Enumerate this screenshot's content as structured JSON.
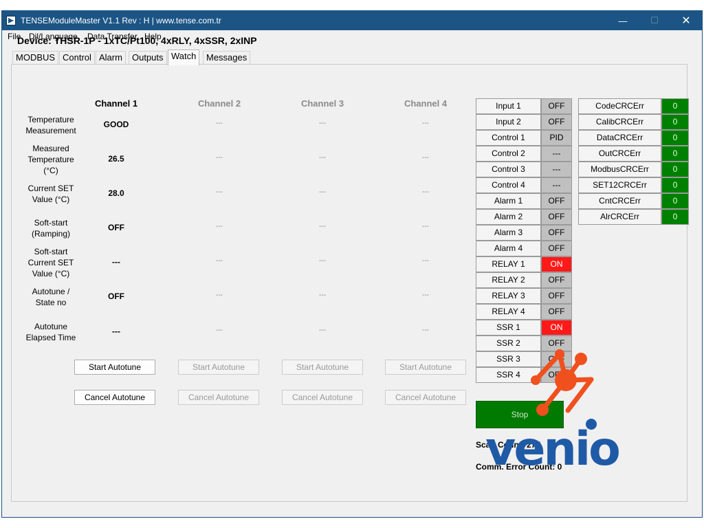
{
  "window": {
    "title": "TENSEModuleMaster V1.1 Rev : H  |  www.tense.com.tr",
    "controls": {
      "minimize": "—",
      "maximize": "☐",
      "close": "✕"
    }
  },
  "menu": [
    "File",
    "Dil/Language",
    "Data Transfer",
    "Help"
  ],
  "device_title": "Device: THSR-1P  -  1xTC/Pt100, 4xRLY, 4xSSR, 2xINP",
  "tabs": [
    "MODBUS",
    "Control",
    "Alarm",
    "Outputs",
    "Watch",
    "Messages"
  ],
  "active_tab": "Watch",
  "channels": [
    "Channel 1",
    "Channel 2",
    "Channel 3",
    "Channel 4"
  ],
  "rows": [
    {
      "label": "Temperature\nMeasurement",
      "values": [
        "GOOD",
        "---",
        "---",
        "---"
      ]
    },
    {
      "label": "Measured\nTemperature\n(°C)",
      "values": [
        "26.5",
        "---",
        "---",
        "---"
      ]
    },
    {
      "label": "Current SET\nValue (°C)",
      "values": [
        "28.0",
        "---",
        "---",
        "---"
      ]
    },
    {
      "label": "Soft-start\n(Ramping)",
      "values": [
        "OFF",
        "---",
        "---",
        "---"
      ]
    },
    {
      "label": "Soft-start\nCurrent SET\nValue (°C)",
      "values": [
        "---",
        "---",
        "---",
        "---"
      ]
    },
    {
      "label": "Autotune /\nState no",
      "values": [
        "OFF",
        "---",
        "---",
        "---"
      ]
    },
    {
      "label": "Autotune\nElapsed Time",
      "values": [
        "---",
        "---",
        "---",
        "---"
      ]
    }
  ],
  "buttons": {
    "start_autotune": "Start Autotune",
    "cancel_autotune": "Cancel Autotune"
  },
  "status": [
    {
      "label": "Input 1",
      "value": "OFF",
      "state": "off"
    },
    {
      "label": "Input 2",
      "value": "OFF",
      "state": "off"
    },
    {
      "label": "Control 1",
      "value": "PID",
      "state": "off"
    },
    {
      "label": "Control 2",
      "value": "---",
      "state": "off"
    },
    {
      "label": "Control 3",
      "value": "---",
      "state": "off"
    },
    {
      "label": "Control 4",
      "value": "---",
      "state": "off"
    },
    {
      "label": "Alarm 1",
      "value": "OFF",
      "state": "off"
    },
    {
      "label": "Alarm 2",
      "value": "OFF",
      "state": "off"
    },
    {
      "label": "Alarm 3",
      "value": "OFF",
      "state": "off"
    },
    {
      "label": "Alarm 4",
      "value": "OFF",
      "state": "off"
    },
    {
      "label": "RELAY 1",
      "value": "ON",
      "state": "on"
    },
    {
      "label": "RELAY 2",
      "value": "OFF",
      "state": "off"
    },
    {
      "label": "RELAY 3",
      "value": "OFF",
      "state": "off"
    },
    {
      "label": "RELAY 4",
      "value": "OFF",
      "state": "off"
    },
    {
      "label": "SSR 1",
      "value": "ON",
      "state": "on"
    },
    {
      "label": "SSR 2",
      "value": "OFF",
      "state": "off"
    },
    {
      "label": "SSR 3",
      "value": "OFF",
      "state": "off"
    },
    {
      "label": "SSR 4",
      "value": "OFF",
      "state": "off"
    }
  ],
  "crc_errors": [
    {
      "label": "CodeCRCErr",
      "value": "0"
    },
    {
      "label": "CalibCRCErr",
      "value": "0"
    },
    {
      "label": "DataCRCErr",
      "value": "0"
    },
    {
      "label": "OutCRCErr",
      "value": "0"
    },
    {
      "label": "ModbusCRCErr",
      "value": "0"
    },
    {
      "label": "SET12CRCErr",
      "value": "0"
    },
    {
      "label": "CntCRCErr",
      "value": "0"
    },
    {
      "label": "AlrCRCErr",
      "value": "0"
    }
  ],
  "stop_button": "Stop",
  "scan_count": "Scan Count: 277",
  "comm_error_count": "Comm. Error Count: 0",
  "watermark_text": "venio",
  "colors": {
    "titlebar": "#1c5585",
    "status_off": "#c0c0c0",
    "status_on": "#ff1a1a",
    "crc_ok": "#008000",
    "stop": "#007a00",
    "watermark_blue": "#1f5aa6",
    "watermark_orange": "#f0501e"
  }
}
